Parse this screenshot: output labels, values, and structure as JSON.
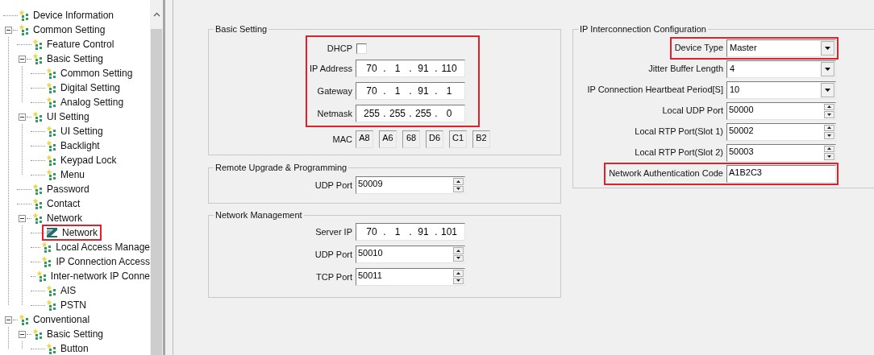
{
  "tree": [
    {
      "label": "Device Information",
      "selected": false,
      "highlighted": false
    },
    {
      "label": "Common Setting",
      "selected": false,
      "highlighted": false,
      "expanded": true,
      "children": [
        {
          "label": "Feature Control",
          "selected": false,
          "highlighted": false
        },
        {
          "label": "Basic Setting",
          "selected": false,
          "highlighted": false,
          "expanded": true,
          "children": [
            {
              "label": "Common Setting",
              "selected": false,
              "highlighted": false
            },
            {
              "label": "Digital Setting",
              "selected": false,
              "highlighted": false
            },
            {
              "label": "Analog Setting",
              "selected": false,
              "highlighted": false
            }
          ]
        },
        {
          "label": "UI Setting",
          "selected": false,
          "highlighted": false,
          "expanded": true,
          "children": [
            {
              "label": "UI Setting",
              "selected": false,
              "highlighted": false
            },
            {
              "label": "Backlight",
              "selected": false,
              "highlighted": false
            },
            {
              "label": "Keypad Lock",
              "selected": false,
              "highlighted": false
            },
            {
              "label": "Menu",
              "selected": false,
              "highlighted": false
            }
          ]
        },
        {
          "label": "Password",
          "selected": false,
          "highlighted": false
        },
        {
          "label": "Contact",
          "selected": false,
          "highlighted": false
        },
        {
          "label": "Network",
          "selected": false,
          "highlighted": false,
          "expanded": true,
          "children": [
            {
              "label": "Network",
              "selected": true,
              "highlighted": true
            },
            {
              "label": "Local Access Manage",
              "selected": false,
              "highlighted": false
            },
            {
              "label": "IP Connection Access",
              "selected": false,
              "highlighted": false
            },
            {
              "label": "Inter-network IP Conne",
              "selected": false,
              "highlighted": false
            },
            {
              "label": "AIS",
              "selected": false,
              "highlighted": false
            },
            {
              "label": "PSTN",
              "selected": false,
              "highlighted": false
            }
          ]
        }
      ]
    },
    {
      "label": "Conventional",
      "selected": false,
      "highlighted": false,
      "expanded": true,
      "children": [
        {
          "label": "Basic Setting",
          "selected": false,
          "highlighted": false,
          "expanded": true,
          "children": [
            {
              "label": "Button",
              "selected": false,
              "highlighted": false
            }
          ]
        }
      ]
    }
  ],
  "ip_separator": ".",
  "basic_setting": {
    "title": "Basic Setting",
    "highlighted": true,
    "dhcp": {
      "label": "DHCP",
      "checked": false
    },
    "addresses": [
      {
        "label": "IP Address",
        "octets": [
          "70",
          "1",
          "91",
          "110"
        ]
      },
      {
        "label": "Gateway",
        "octets": [
          "70",
          "1",
          "91",
          "1"
        ]
      },
      {
        "label": "Netmask",
        "octets": [
          "255",
          "255",
          "255",
          "0"
        ]
      }
    ],
    "mac": {
      "label": "MAC",
      "bytes": [
        "A8",
        "A6",
        "68",
        "D6",
        "C1",
        "B2"
      ]
    }
  },
  "remote_upgrade": {
    "title": "Remote Upgrade & Programming",
    "fields": [
      {
        "label": "UDP Port",
        "value": "50009"
      }
    ]
  },
  "network_management": {
    "title": "Network Management",
    "server_ip": {
      "label": "Server IP",
      "octets": [
        "70",
        "1",
        "91",
        "101"
      ]
    },
    "fields": [
      {
        "label": "UDP Port",
        "value": "50010"
      },
      {
        "label": "TCP Port",
        "value": "50011"
      }
    ]
  },
  "ip_interconnection": {
    "title": "IP Interconnection Configuration",
    "fields": [
      {
        "kind": "dropdown",
        "label": "Device Type",
        "value": "Master",
        "highlighted": true
      },
      {
        "kind": "dropdown",
        "label": "Jitter Buffer Length",
        "value": "4",
        "highlighted": false
      },
      {
        "kind": "dropdown",
        "label": "IP Connection Heartbeat Period[S]",
        "value": "10",
        "highlighted": false
      },
      {
        "kind": "spin",
        "label": "Local UDP Port",
        "value": "50000",
        "highlighted": false
      },
      {
        "kind": "spin",
        "label": "Local RTP Port(Slot 1)",
        "value": "50002",
        "highlighted": false
      },
      {
        "kind": "spin",
        "label": "Local RTP Port(Slot 2)",
        "value": "50003",
        "highlighted": false
      },
      {
        "kind": "text",
        "label": "Network Authentication Code",
        "value": "A1B2C3",
        "highlighted": true
      }
    ]
  }
}
